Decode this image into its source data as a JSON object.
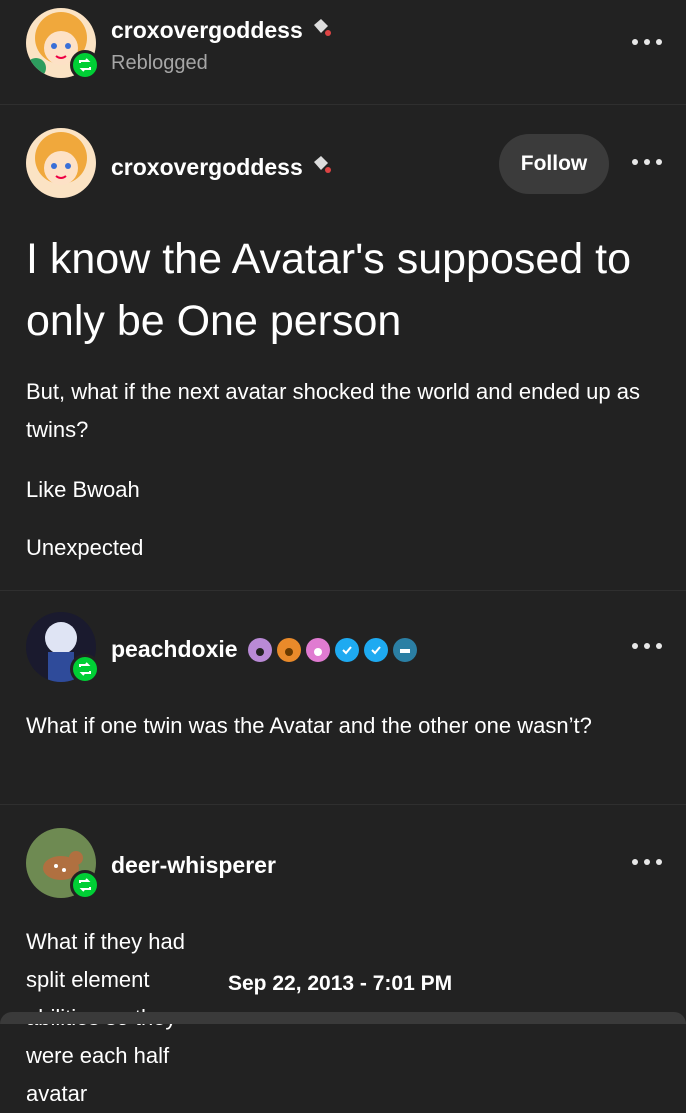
{
  "reblog_header": {
    "username": "croxovergoddess",
    "status": "Reblogged"
  },
  "original_post": {
    "username": "croxovergoddess",
    "follow_label": "Follow",
    "title": "I know the Avatar's supposed to only be One person",
    "paragraphs": [
      "But, what if the next avatar shocked the world and ended up as twins?",
      "Like Bwoah",
      "Unexpected"
    ]
  },
  "replies": [
    {
      "username": "peachdoxie",
      "text": "What if one twin was the Avatar and the other one wasn’t?",
      "badges": [
        "paw-badge-icon",
        "paw-badge-icon",
        "paw-badge-icon",
        "verified-badge-icon",
        "verified-badge-icon",
        "bird-badge-icon"
      ]
    },
    {
      "username": "deer-whisperer",
      "text": "What if they had split element abilities so they were each half avatar"
    }
  ],
  "timestamp": "Sep 22, 2013 - 7:01 PM",
  "colors": {
    "background": "#222222",
    "reblog_green": "#00cf35",
    "secondary_text": "#a6a6a6",
    "verified_blue": "#1eaaf1"
  }
}
